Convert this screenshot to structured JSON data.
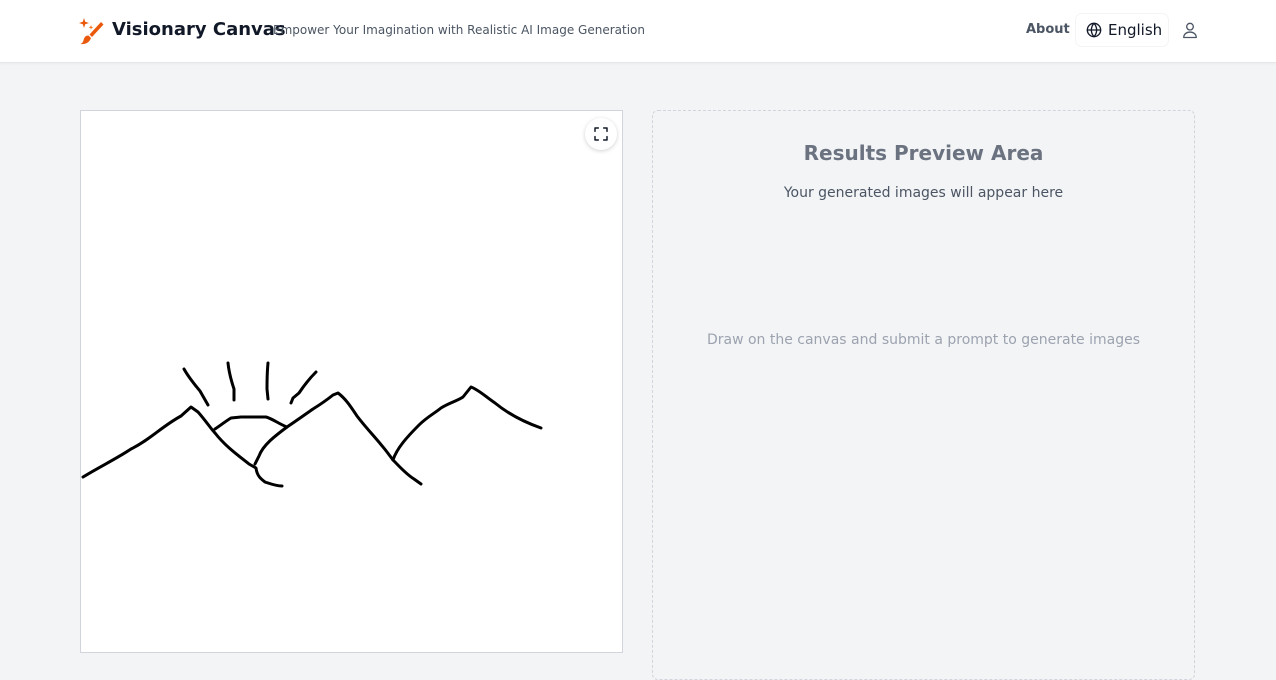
{
  "header": {
    "brand": "Visionary Canvas",
    "tagline": "Empower Your Imagination with Realistic AI Image Generation",
    "logo_icon": "paintbrush-sparkle-icon",
    "nav": {
      "about_label": "About",
      "language_label": "English",
      "language_icon": "globe-icon",
      "user_icon": "user-icon"
    }
  },
  "canvas": {
    "fullscreen_icon": "fullscreen-icon",
    "stroke_color": "#000000"
  },
  "results": {
    "title": "Results Preview Area",
    "subtitle": "Your generated images will appear here",
    "hint": "Draw on the canvas and submit a prompt to generate images"
  },
  "colors": {
    "accent": "#ea580c",
    "background": "#f3f4f6",
    "header_bg": "#ffffff"
  }
}
